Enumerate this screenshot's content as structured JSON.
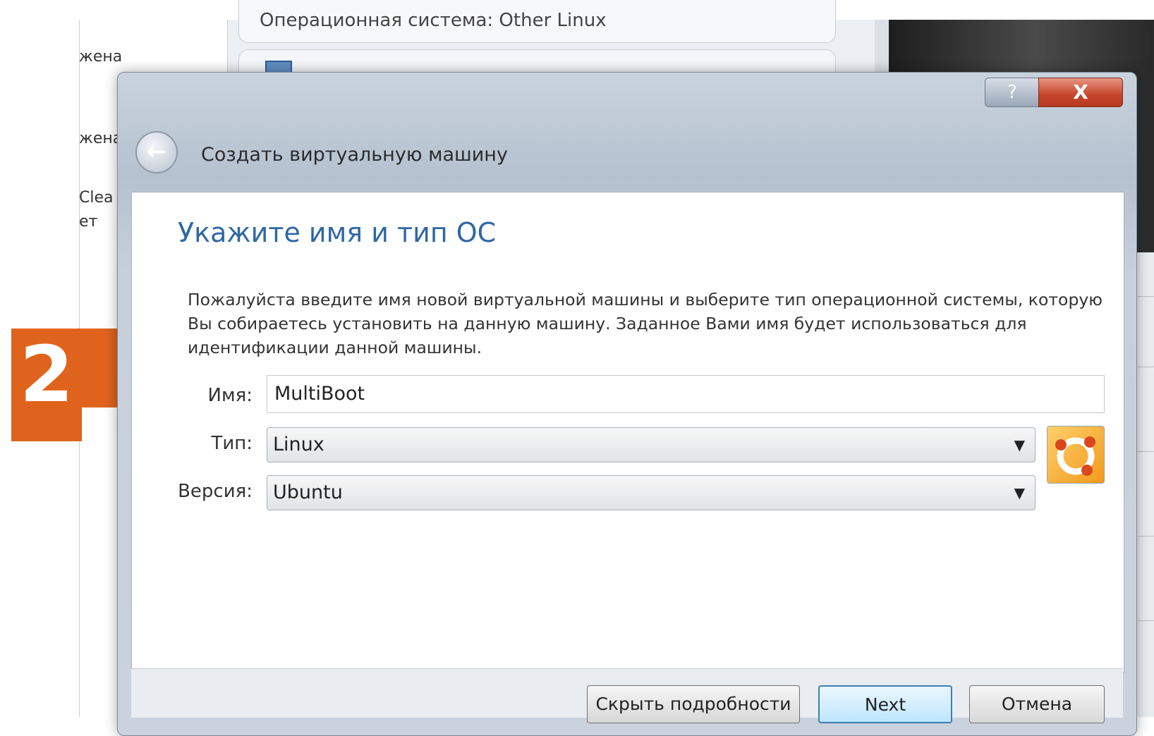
{
  "background": {
    "os_type_line": "Операционная система:   Other Linux",
    "left_list_fragments": [
      "жена",
      "жена",
      "Clea",
      "ет"
    ]
  },
  "step_badge": "2",
  "dialog": {
    "help_glyph": "?",
    "close_glyph": "X",
    "back_glyph": "←",
    "wizard_title": "Создать виртуальную машину",
    "page_title": "Укажите имя и тип ОС",
    "description": "Пожалуйста введите имя новой виртуальной машины и выберите тип операционной системы, которую Вы собираетесь установить на данную машину. Заданное Вами имя будет использоваться для идентификации данной машины.",
    "fields": {
      "name_label": "Имя:",
      "name_value": "MultiBoot",
      "type_label": "Тип:",
      "type_value": "Linux",
      "version_label": "Версия:",
      "version_value": "Ubuntu"
    },
    "buttons": {
      "hide_details": "Скрыть подробности",
      "next": "Next",
      "cancel": "Отмена"
    },
    "dropdown_arrow": "▼",
    "os_icon": "ubuntu-logo-icon"
  }
}
